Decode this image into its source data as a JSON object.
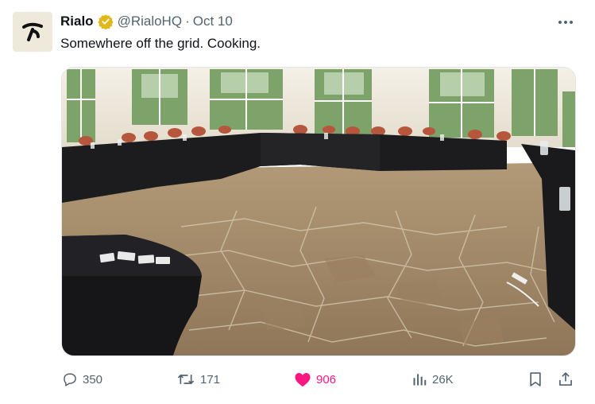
{
  "tweet": {
    "display_name": "Rialo",
    "handle": "@RialoHQ",
    "separator": "·",
    "date": "Oct 10",
    "text": "Somewhere off the grid. Cooking.",
    "verified": true
  },
  "media": {
    "description_icon": "photo-media"
  },
  "actions": {
    "replies": "350",
    "reposts": "171",
    "likes": "906",
    "views": "26K"
  },
  "icons": {
    "reply": "reply-icon",
    "repost": "repost-icon",
    "like": "heart-icon",
    "views": "views-icon",
    "bookmark": "bookmark-icon",
    "share": "share-icon",
    "more": "more-icon",
    "verified": "verified-badge-icon"
  },
  "colors": {
    "text": "#0f1419",
    "muted": "#536471",
    "like": "#f91880",
    "badge": "#e2b719"
  }
}
